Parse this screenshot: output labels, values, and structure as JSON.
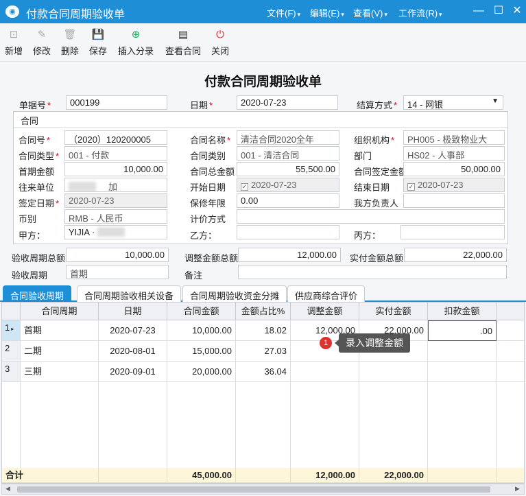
{
  "window": {
    "title": "付款合同周期验收单",
    "logo": "logo-icon",
    "minimize": "—",
    "maximize": "☐",
    "close": "✕"
  },
  "menu": [
    "文件(F)",
    "编辑(E)",
    "查看(V)",
    "工作流(R)"
  ],
  "toolbar": [
    {
      "label": "新增",
      "icon": "new-icon",
      "glyph": "⊡"
    },
    {
      "label": "修改",
      "icon": "edit-icon",
      "glyph": "✎"
    },
    {
      "label": "删除",
      "icon": "trash-icon",
      "glyph": "🗑"
    },
    {
      "label": "保存",
      "icon": "save-icon",
      "glyph": "💾"
    },
    {
      "label": "插入分录",
      "icon": "plus-circle-icon",
      "glyph": "⊕"
    },
    {
      "label": "查看合同",
      "icon": "document-icon",
      "glyph": "▤"
    },
    {
      "label": "关闭",
      "icon": "power-icon",
      "glyph": "⏻"
    }
  ],
  "form_title": "付款合同周期验收单",
  "header": {
    "doc_no_label": "单据号",
    "doc_no": "000199",
    "date_label": "日期",
    "date": "2020-07-23",
    "settle_label": "结算方式",
    "settle": "14 - 网银"
  },
  "contract": {
    "group_label": "合同",
    "no_label": "合同号",
    "no": "（2020）120200005",
    "name_label": "合同名称",
    "name": "清洁合同2020全年",
    "org_label": "组织机构",
    "org": "PH005 - 极致物业大",
    "type_label": "合同类型",
    "type": "001 - 付款",
    "category_label": "合同类别",
    "category": "001 - 清洁合同",
    "dept_label": "部门",
    "dept": "HS02 - 人事部",
    "first_amt_label": "首期金额",
    "first_amt": "10,000.00",
    "total_label": "合同总金额",
    "total": "55,500.00",
    "signed_amt_label": "合同签定金额",
    "signed_amt": "50,000.00",
    "partner_label": "往来单位",
    "partner": "加",
    "start_label": "开始日期",
    "start": "2020-07-23",
    "end_label": "结束日期",
    "end": "2020-07-23",
    "sign_date_label": "签定日期",
    "sign_date": "2020-07-23",
    "warranty_label": "保修年限",
    "warranty": "0.00",
    "our_owner_label": "我方负责人",
    "our_owner": "",
    "currency_label": "币别",
    "currency": "RMB - 人民币",
    "pricing_label": "计价方式",
    "pricing": "",
    "party_a_label": "甲方：",
    "party_a": "YIJIA ·",
    "party_b_label": "乙方：",
    "party_b": "",
    "party_c_label": "丙方：",
    "party_c": ""
  },
  "summary": {
    "cycle_total_label": "验收周期总额",
    "cycle_total": "10,000.00",
    "adjust_total_label": "调整金额总额",
    "adjust_total": "12,000.00",
    "paid_total_label": "实付金额总额",
    "paid_total": "22,000.00",
    "cycle_label": "验收周期",
    "cycle": "首期",
    "remark_label": "备注",
    "remark": ""
  },
  "tabs": [
    "合同验收周期",
    "合同周期验收相关设备",
    "合同周期验收资金分摊",
    "供应商综合评价"
  ],
  "grid": {
    "columns": [
      "合同周期",
      "日期",
      "合同金额",
      "金额占比%",
      "调整金额",
      "实付金额",
      "扣款金额"
    ],
    "rows": [
      {
        "no": "1",
        "period": "首期",
        "date": "2020-07-23",
        "amount": "10,000.00",
        "ratio": "18.02",
        "adjust": "12,000.00",
        "paid": "22,000.00",
        "deduct": ".00"
      },
      {
        "no": "2",
        "period": "二期",
        "date": "2020-08-01",
        "amount": "15,000.00",
        "ratio": "27.03",
        "adjust": "",
        "paid": "",
        "deduct": ""
      },
      {
        "no": "3",
        "period": "三期",
        "date": "2020-09-01",
        "amount": "20,000.00",
        "ratio": "36.04",
        "adjust": "",
        "paid": "",
        "deduct": ""
      }
    ],
    "total_label": "合计",
    "total_amount": "45,000.00",
    "total_adjust": "12,000.00",
    "total_paid": "22,000.00"
  },
  "tip": {
    "num": "1",
    "text": "录入调整金额"
  },
  "colors": {
    "titlebar": "#1e8fd6",
    "required": "#d0021b",
    "tip": "#555555",
    "badge": "#e03131",
    "total_row": "#fdf6d8"
  }
}
